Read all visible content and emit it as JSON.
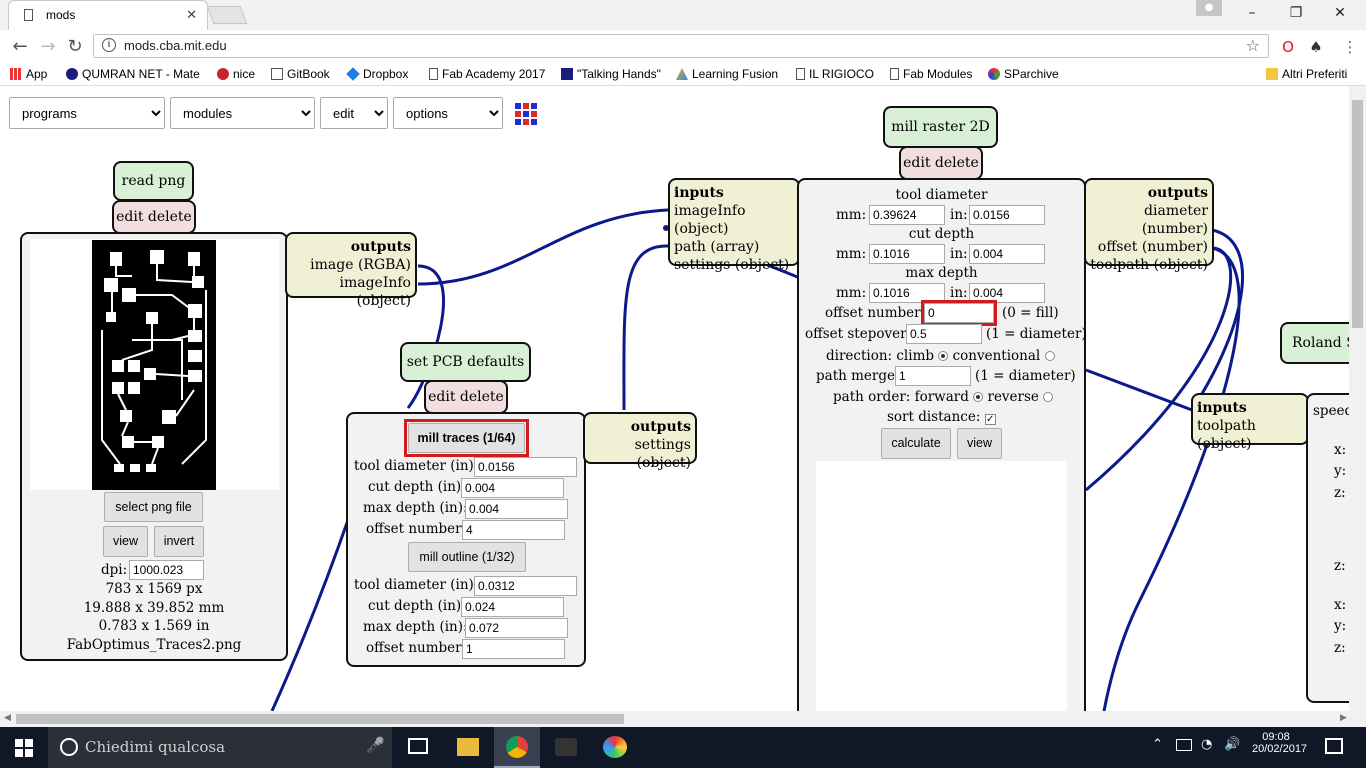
{
  "browser": {
    "tab_title": "mods",
    "url": "mods.cba.mit.edu",
    "bookmarks": [
      "App",
      "QUMRAN NET - Mate",
      "nice",
      "GitBook",
      "Dropbox",
      "Fab Academy 2017",
      "\"Talking Hands\"",
      "Learning Fusion",
      "IL RIGIOCO",
      "Fab Modules",
      "SParchive"
    ],
    "other_bookmarks": "Altri Preferiti"
  },
  "menu": {
    "programs": "programs",
    "modules": "modules",
    "edit": "edit",
    "options": "options"
  },
  "read_png": {
    "title": "read png",
    "edit_delete": "edit delete",
    "select_button": "select png file",
    "view_button": "view",
    "invert_button": "invert",
    "dpi_label": "dpi:",
    "dpi_value": "1000.023",
    "px_size": "783 x 1569 px",
    "mm_size": "19.888 x 39.852 mm",
    "in_size": "0.783 x 1.569 in",
    "filename": "FabOptimus_Traces2.png",
    "outputs_title": "outputs",
    "outputs": [
      "image (RGBA)",
      "imageInfo (object)"
    ]
  },
  "pcb_defaults": {
    "title": "set PCB defaults",
    "edit_delete": "edit delete",
    "traces_button": "mill traces (1/64)",
    "outline_button": "mill outline (1/32)",
    "traces": [
      {
        "label": "tool diameter (in):",
        "value": "0.0156"
      },
      {
        "label": "cut depth (in):",
        "value": "0.004"
      },
      {
        "label": "max depth (in):",
        "value": "0.004"
      },
      {
        "label": "offset number:",
        "value": "4"
      }
    ],
    "outline": [
      {
        "label": "tool diameter (in):",
        "value": "0.0312"
      },
      {
        "label": "cut depth (in):",
        "value": "0.024"
      },
      {
        "label": "max depth (in):",
        "value": "0.072"
      },
      {
        "label": "offset number:",
        "value": "1"
      }
    ],
    "outputs_title": "outputs",
    "outputs": [
      "settings (object)"
    ]
  },
  "mill_raster": {
    "title": "mill raster 2D",
    "edit_delete": "edit delete",
    "inputs_title": "inputs",
    "inputs": [
      "imageInfo (object)",
      "path (array)",
      "settings (object)"
    ],
    "tool_diameter_title": "tool diameter",
    "tool_mm": "0.39624",
    "tool_in": "0.0156",
    "cut_depth_title": "cut depth",
    "cut_mm": "0.1016",
    "cut_in": "0.004",
    "max_depth_title": "max depth",
    "max_mm": "0.1016",
    "max_in": "0.004",
    "mm_label": "mm:",
    "in_label": "in:",
    "offset_number_label": "offset number:",
    "offset_number_value": "0",
    "offset_number_hint": "(0 = fill)",
    "stepover_label": "offset stepover:",
    "stepover_value": "0.5",
    "stepover_hint": "(1 = diameter)",
    "direction_label": "direction: climb",
    "direction_alt": "conventional",
    "merge_label": "path merge:",
    "merge_value": "1",
    "merge_hint": "(1 = diameter)",
    "order_label": "path order: forward",
    "order_alt": "reverse",
    "sort_label": "sort distance:",
    "calculate_button": "calculate",
    "view_button": "view",
    "outputs_title": "outputs",
    "outputs": [
      "diameter (number)",
      "offset (number)",
      "toolpath (object)"
    ]
  },
  "roland": {
    "title": "Roland S",
    "inputs_title": "inputs",
    "inputs": [
      "toolpath (object)"
    ],
    "fields": [
      "speed",
      "x:",
      "y:",
      "z:",
      "z:",
      "x:",
      "y:",
      "z:"
    ]
  },
  "taskbar": {
    "search_placeholder": "Chiedimi qualcosa",
    "time": "09:08",
    "date": "20/02/2017"
  },
  "colors": {
    "wire": "#0a1a8a",
    "highlight": "#d01c1c",
    "label_bg": "#d7f0d6",
    "edit_bg": "#f2dede",
    "io_bg": "#f0f0d4"
  }
}
